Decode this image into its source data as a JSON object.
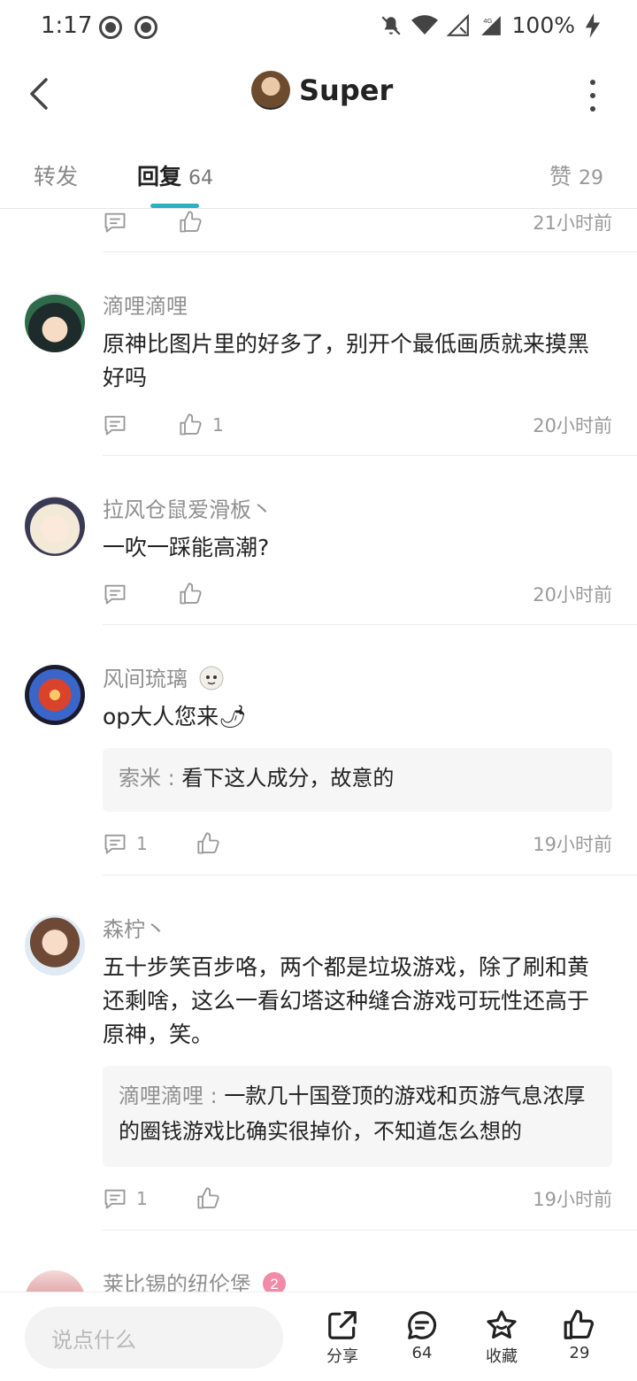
{
  "status_bar": {
    "time": "1:17",
    "battery": "100%"
  },
  "header": {
    "back_icon": "back-icon",
    "title": "Super",
    "more_icon": "more-icon"
  },
  "tabs": {
    "forward_label": "转发",
    "reply_label": "回复",
    "reply_count": "64",
    "like_label": "赞",
    "like_count": "29"
  },
  "feed": {
    "top_partial": {
      "time": "21小时前"
    },
    "comments": [
      {
        "username": "滴哩滴哩",
        "text": "原神比图片里的好多了，别开个最低画质就来摸黑好吗",
        "reply_count": "",
        "like_count": "1",
        "time": "20小时前"
      },
      {
        "username": "拉风仓鼠爱滑板丶",
        "text": "一吹一踩能高潮?",
        "reply_count": "",
        "like_count": "",
        "time": "20小时前"
      },
      {
        "username": "风间琉璃",
        "text": "op大人您来🌶",
        "reply": {
          "name": "索米",
          "text": "看下这人成分，故意的"
        },
        "reply_count": "1",
        "like_count": "",
        "time": "19小时前"
      },
      {
        "username": "森柠丶",
        "text": "五十步笑百步咯，两个都是垃圾游戏，除了刷和黄还剩啥，这么一看幻塔这种缝合游戏可玩性还高于原神，笑。",
        "reply": {
          "name": "滴哩滴哩",
          "text": "一款几十国登顶的游戏和页游气息浓厚的圈钱游戏比确实很掉价，不知道怎么想的"
        },
        "reply_count": "1",
        "like_count": "",
        "time": "19小时前"
      },
      {
        "username": "莱比锡的纽伦堡"
      }
    ]
  },
  "bottom_bar": {
    "input_placeholder": "说点什么",
    "share_label": "分享",
    "comments_count": "64",
    "favorite_label": "收藏",
    "likes_count": "29"
  },
  "colors": {
    "accent": "#26b4c2",
    "muted": "#9a9a9a",
    "text": "#222222"
  }
}
